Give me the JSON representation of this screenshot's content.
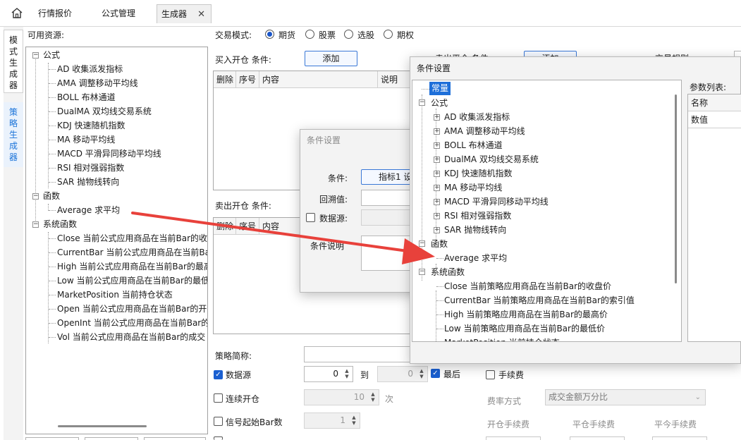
{
  "tabs": [
    {
      "label": "行情报价"
    },
    {
      "label": "公式管理"
    },
    {
      "label": "生成器"
    }
  ],
  "vertical_tabs": [
    {
      "chars": [
        "模",
        "式",
        "生",
        "成",
        "器"
      ]
    },
    {
      "chars": [
        "策",
        "略",
        "生",
        "成",
        "器"
      ]
    }
  ],
  "left_panel": {
    "title": "可用资源:",
    "groups": [
      {
        "label": "公式",
        "items": [
          "AD 收集派发指标",
          "AMA 调整移动平均线",
          "BOLL 布林通道",
          "DualMA 双均线交易系统",
          "KDJ 快速随机指数",
          "MA 移动平均线",
          "MACD 平滑异同移动平均线",
          "RSI 相对强弱指数",
          "SAR 抛物线转向"
        ]
      },
      {
        "label": "函数",
        "items": [
          "Average 求平均"
        ]
      },
      {
        "label": "系统函数",
        "items": [
          "Close 当前公式应用商品在当前Bar的收",
          "CurrentBar 当前公式应用商品在当前Ba",
          "High 当前公式应用商品在当前Bar的最高",
          "Low 当前公式应用商品在当前Bar的最低",
          "MarketPosition 当前持仓状态",
          "Open 当前公式应用商品在当前Bar的开",
          "OpenInt 当前公式应用商品在当前Bar的",
          "Vol 当前公式应用商品在当前Bar的成交"
        ]
      }
    ]
  },
  "trade_mode": {
    "label": "交易模式:",
    "options": [
      "期货",
      "股票",
      "选股",
      "期权"
    ],
    "selected": "期货"
  },
  "buy_open": {
    "label": "买入开仓 条件:",
    "add_button": "添加",
    "columns": [
      "删除",
      "序号",
      "内容",
      "说明"
    ]
  },
  "sell_open": {
    "label": "卖出开仓 条件:",
    "columns": [
      "删除",
      "序号",
      "内容"
    ]
  },
  "bottom_form": {
    "strategy_name_label": "策略简称:",
    "datasource_label": "数据源",
    "datasource_from": "0",
    "to_label": "到",
    "datasource_to": "0",
    "last_label": "最后",
    "fee_label": "手续费",
    "continuous_label": "连续开仓",
    "continuous_value": "10",
    "times_label": "次",
    "fee_mode_label": "费率方式",
    "fee_mode_value": "成交金额万分比",
    "signal_bar_label": "信号起始Bar数",
    "signal_bar_value": "1",
    "open_fee_label": "开仓手续费",
    "close_fee_label": "平仓手续费",
    "close_today_fee_label": "平今手续费"
  },
  "bg_dialog": {
    "title": "条件设置",
    "condition_label": "条件:",
    "condition_value": "指标1 设",
    "backtrack_label": "回溯值:",
    "datasource_label": "数据源:",
    "desc_label": "条件说明"
  },
  "peek_headers": {
    "sell_close_label": "卖出平仓 条件:",
    "add_button": "添加",
    "trade_rule_label": "交易规则:"
  },
  "fg_dialog": {
    "title": "条件设置",
    "params_label": "参数列表:",
    "params_header": "名称",
    "params_row": "数值",
    "tree": {
      "constant": "常量",
      "groups": [
        {
          "label": "公式",
          "items": [
            "AD 收集派发指标",
            "AMA 调整移动平均线",
            "BOLL 布林通道",
            "DualMA 双均线交易系统",
            "KDJ 快速随机指数",
            "MA 移动平均线",
            "MACD 平滑异同移动平均线",
            "RSI 相对强弱指数",
            "SAR 抛物线转向"
          ]
        },
        {
          "label": "函数",
          "items": [
            "Average 求平均"
          ]
        },
        {
          "label": "系统函数",
          "items": [
            "Close 当前策略应用商品在当前Bar的收盘价",
            "CurrentBar 当前策略应用商品在当前Bar的索引值",
            "High 当前策略应用商品在当前Bar的最高价",
            "Low 当前策略应用商品在当前Bar的最低价",
            "MarketPosition 当前持仓状态"
          ]
        }
      ]
    }
  },
  "arrow_color": "#e8413b"
}
